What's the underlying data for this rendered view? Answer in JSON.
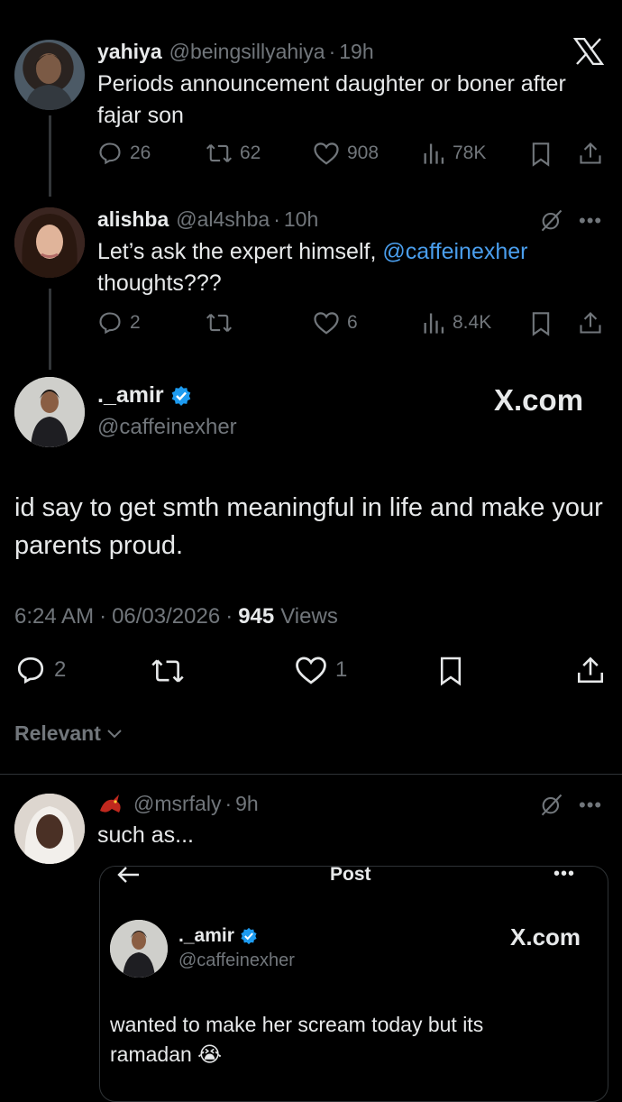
{
  "tweet1": {
    "name": "yahiya",
    "handle": "@beingsillyahiya",
    "time": "19h",
    "text": "Periods announcement daughter or boner after fajar son",
    "replies": "26",
    "retweets": "62",
    "likes": "908",
    "views": "78K"
  },
  "tweet2": {
    "name": "alishba",
    "handle": "@al4shba",
    "time": "10h",
    "text_before": "Let’s ask the expert himself, ",
    "mention": "@caffeinexher",
    "text_after": "thoughts???",
    "replies": "2",
    "likes": "6",
    "views": "8.4K"
  },
  "main_tweet": {
    "name": "._amir",
    "handle": "@caffeinexher",
    "brand": "X.com",
    "text": "id say to get smth meaningful in life and make your parents proud.",
    "time": "6:24 AM",
    "date": "06/03/2026",
    "views_count": "945",
    "views_label": "Views",
    "replies": "2",
    "likes": "1"
  },
  "sort": {
    "label": "Relevant"
  },
  "reply": {
    "handle": "@msrfaly",
    "time": "9h",
    "text": "such as...",
    "quote": {
      "header_title": "Post",
      "name": "._amir",
      "handle": "@caffeinexher",
      "brand": "X.com",
      "text": "wanted to make her scream today but its ramadan 😭"
    }
  },
  "colors": {
    "accent": "#1d9bf0",
    "mention": "#4a9eed",
    "muted": "#71767b",
    "text": "#e7e9ea",
    "bg": "#000000"
  }
}
